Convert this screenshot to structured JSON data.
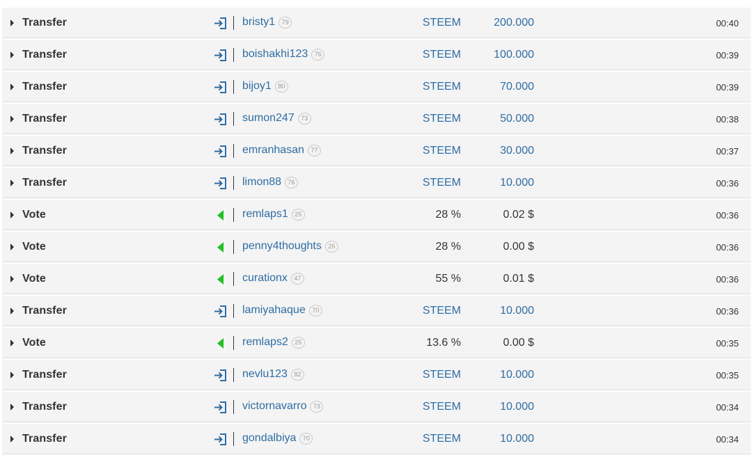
{
  "colors": {
    "link": "#2e6da4",
    "vote_green": "#22c022",
    "transfer_icon": "#2e6da4",
    "row_bg": "#f4f4f4"
  },
  "operations": [
    {
      "type": "Transfer",
      "icon": "transfer-icon",
      "user": "bristy1",
      "rep": "79",
      "col1": "STEEM",
      "col2": "200.000",
      "time": "00:40"
    },
    {
      "type": "Transfer",
      "icon": "transfer-icon",
      "user": "boishakhi123",
      "rep": "76",
      "col1": "STEEM",
      "col2": "100.000",
      "time": "00:39"
    },
    {
      "type": "Transfer",
      "icon": "transfer-icon",
      "user": "bijoy1",
      "rep": "80",
      "col1": "STEEM",
      "col2": "70.000",
      "time": "00:39"
    },
    {
      "type": "Transfer",
      "icon": "transfer-icon",
      "user": "sumon247",
      "rep": "73",
      "col1": "STEEM",
      "col2": "50.000",
      "time": "00:38"
    },
    {
      "type": "Transfer",
      "icon": "transfer-icon",
      "user": "emranhasan",
      "rep": "77",
      "col1": "STEEM",
      "col2": "30.000",
      "time": "00:37"
    },
    {
      "type": "Transfer",
      "icon": "transfer-icon",
      "user": "limon88",
      "rep": "76",
      "col1": "STEEM",
      "col2": "10.000",
      "time": "00:36"
    },
    {
      "type": "Vote",
      "icon": "upvote-icon",
      "user": "remlaps1",
      "rep": "25",
      "col1": "28 %",
      "col2": "0.02 $",
      "time": "00:36"
    },
    {
      "type": "Vote",
      "icon": "upvote-icon",
      "user": "penny4thoughts",
      "rep": "25",
      "col1": "28 %",
      "col2": "0.00 $",
      "time": "00:36"
    },
    {
      "type": "Vote",
      "icon": "upvote-icon",
      "user": "curationx",
      "rep": "47",
      "col1": "55 %",
      "col2": "0.01 $",
      "time": "00:36"
    },
    {
      "type": "Transfer",
      "icon": "transfer-icon",
      "user": "lamiyahaque",
      "rep": "70",
      "col1": "STEEM",
      "col2": "10.000",
      "time": "00:36"
    },
    {
      "type": "Vote",
      "icon": "upvote-icon",
      "user": "remlaps2",
      "rep": "25",
      "col1": "13.6 %",
      "col2": "0.00 $",
      "time": "00:35"
    },
    {
      "type": "Transfer",
      "icon": "transfer-icon",
      "user": "nevlu123",
      "rep": "82",
      "col1": "STEEM",
      "col2": "10.000",
      "time": "00:35"
    },
    {
      "type": "Transfer",
      "icon": "transfer-icon",
      "user": "victornavarro",
      "rep": "73",
      "col1": "STEEM",
      "col2": "10.000",
      "time": "00:34"
    },
    {
      "type": "Transfer",
      "icon": "transfer-icon",
      "user": "gondalbiya",
      "rep": "70",
      "col1": "STEEM",
      "col2": "10.000",
      "time": "00:34"
    }
  ]
}
